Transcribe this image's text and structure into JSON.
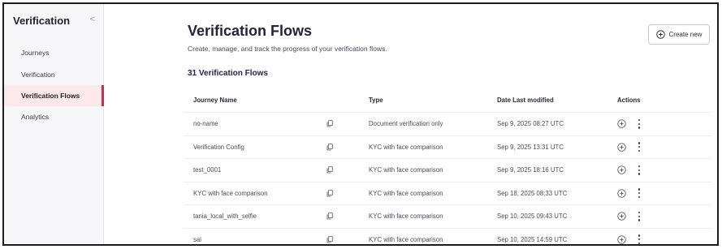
{
  "sidebar": {
    "title": "Verification",
    "collapse_glyph": "<",
    "items": [
      {
        "label": "Journeys",
        "active": false
      },
      {
        "label": "Verification",
        "active": false
      },
      {
        "label": "Verification Flows",
        "active": true
      },
      {
        "label": "Analytics",
        "active": false
      }
    ]
  },
  "header": {
    "title": "Verification Flows",
    "subtitle": "Create, manage, and track the progress of your verification flows.",
    "create_label": "Create new"
  },
  "summary": {
    "count_label": "31 Verification Flows"
  },
  "table": {
    "columns": [
      "Journey Name",
      "",
      "Type",
      "Date Last modified",
      "Actions"
    ],
    "rows": [
      {
        "name": "no-name",
        "type": "Document verification only",
        "date": "Sep 9, 2025 08:27 UTC"
      },
      {
        "name": "Verification Config",
        "type": "KYC with face comparison",
        "date": "Sep 9, 2025 13:31 UTC"
      },
      {
        "name": "test_0001",
        "type": "KYC with face comparison",
        "date": "Sep 9, 2025 18:16 UTC"
      },
      {
        "name": "KYC with face comparison",
        "type": "KYC with face comparison",
        "date": "Sep 18, 2025 08:33 UTC"
      },
      {
        "name": "tania_local_with_selfie",
        "type": "KYC with face comparison",
        "date": "Sep 10, 2025 09:43 UTC"
      },
      {
        "name": "sai",
        "type": "KYC with face comparison",
        "date": "Sep 10, 2025 14:59 UTC"
      }
    ]
  },
  "icons": {
    "create": "plus-circle-icon",
    "copy": "copy-icon",
    "add_action": "plus-circle-icon",
    "more": "kebab-menu-icon"
  },
  "colors": {
    "active_bg": "#fde9ec",
    "active_accent": "#c2334a",
    "title": "#23233a"
  }
}
